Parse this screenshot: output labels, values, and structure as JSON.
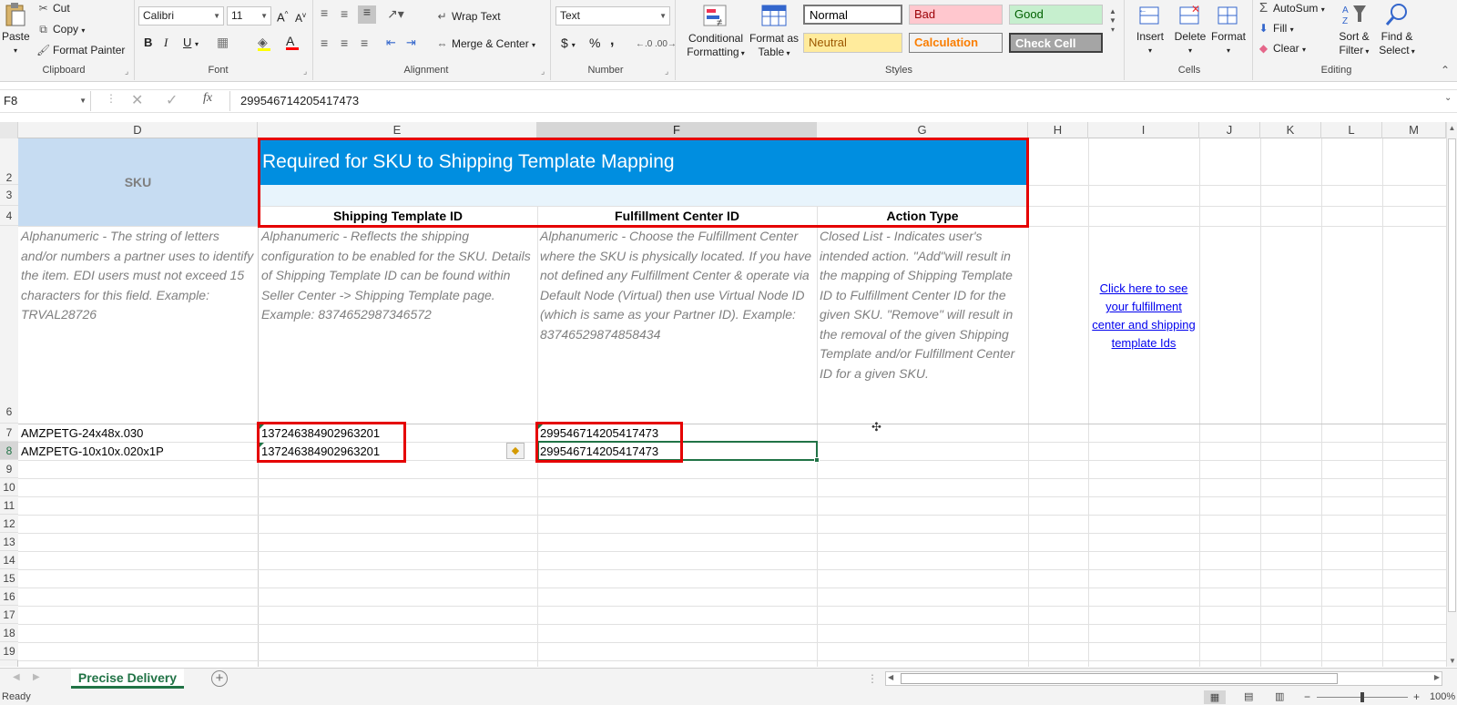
{
  "ribbon": {
    "clipboard": {
      "paste": "Paste",
      "cut": "Cut",
      "copy": "Copy",
      "format_painter": "Format Painter",
      "label": "Clipboard"
    },
    "font": {
      "name": "Calibri",
      "size": "11",
      "label": "Font",
      "bold": "B",
      "italic": "I",
      "underline": "U"
    },
    "alignment": {
      "wrap_text": "Wrap Text",
      "merge_center": "Merge & Center",
      "label": "Alignment"
    },
    "number": {
      "format": "Text",
      "currency": "$",
      "percent": "%",
      "comma": ",",
      "label": "Number"
    },
    "styles": {
      "conditional": "Conditional",
      "formatting": "Formatting",
      "format_as": "Format as",
      "table": "Table",
      "label": "Styles",
      "cells": [
        {
          "name": "Normal"
        },
        {
          "name": "Bad"
        },
        {
          "name": "Good"
        },
        {
          "name": "Neutral"
        },
        {
          "name": "Calculation"
        },
        {
          "name": "Check Cell"
        }
      ]
    },
    "cells": {
      "insert": "Insert",
      "delete": "Delete",
      "format": "Format",
      "label": "Cells"
    },
    "editing": {
      "autosum": "AutoSum",
      "fill": "Fill",
      "clear": "Clear",
      "sort": "Sort &",
      "filter": "Filter",
      "find": "Find &",
      "select": "Select",
      "label": "Editing"
    }
  },
  "formula_bar": {
    "name_box": "F8",
    "fx": "fx",
    "content": "299546714205417473"
  },
  "columns": [
    "D",
    "E",
    "F",
    "G",
    "H",
    "I",
    "J",
    "K",
    "L",
    "M"
  ],
  "rows": [
    "2",
    "3",
    "4",
    "6",
    "7",
    "8",
    "9",
    "10",
    "11",
    "12",
    "13",
    "14",
    "15",
    "16",
    "17",
    "18",
    "19"
  ],
  "sheet": {
    "sku_header": "SKU",
    "banner": "Required for SKU to Shipping Template Mapping",
    "headers": {
      "shipping_template": "Shipping Template ID",
      "fulfillment_center": "Fulfillment Center ID",
      "action_type": "Action Type"
    },
    "desc": {
      "sku": "Alphanumeric - The string of letters and/or numbers a partner uses to identify the item. EDI users must not exceed 15 characters for this field. Example: TRVAL28726",
      "shipping": "Alphanumeric - Reflects the shipping configuration to be enabled for the SKU. Details of Shipping Template ID can be found within Seller Center -> Shipping Template page. Example: 8374652987346572",
      "fulfillment": "Alphanumeric -  Choose the Fulfillment Center where the SKU is physically located. If you have not defined any Fulfillment Center & operate via Default Node (Virtual) then use Virtual Node ID (which is same as your Partner ID). Example: 83746529874858434",
      "action": "Closed List - Indicates user's intended action. \"Add\"will result in the mapping of Shipping Template ID to Fulfillment Center ID for the given SKU. \"Remove\" will result in the removal of the given Shipping Template and/or Fulfillment Center ID for a given SKU."
    },
    "link": "Click here to see your fulfillment center and shipping template Ids",
    "data_rows": [
      {
        "sku": "AMZPETG-24x48x.030",
        "shipping": "137246384902963201",
        "fulfillment": "299546714205417473"
      },
      {
        "sku": "AMZPETG-10x10x.020x1P",
        "shipping": "137246384902963201",
        "fulfillment": "299546714205417473"
      }
    ]
  },
  "sheet_tab": "Precise Delivery",
  "status": {
    "ready": "Ready",
    "zoom": "100%"
  },
  "colors": {
    "banner": "#008ee0",
    "sku_fill": "#c6dcf2",
    "highlight": "#e50000",
    "tab_green": "#217346"
  }
}
